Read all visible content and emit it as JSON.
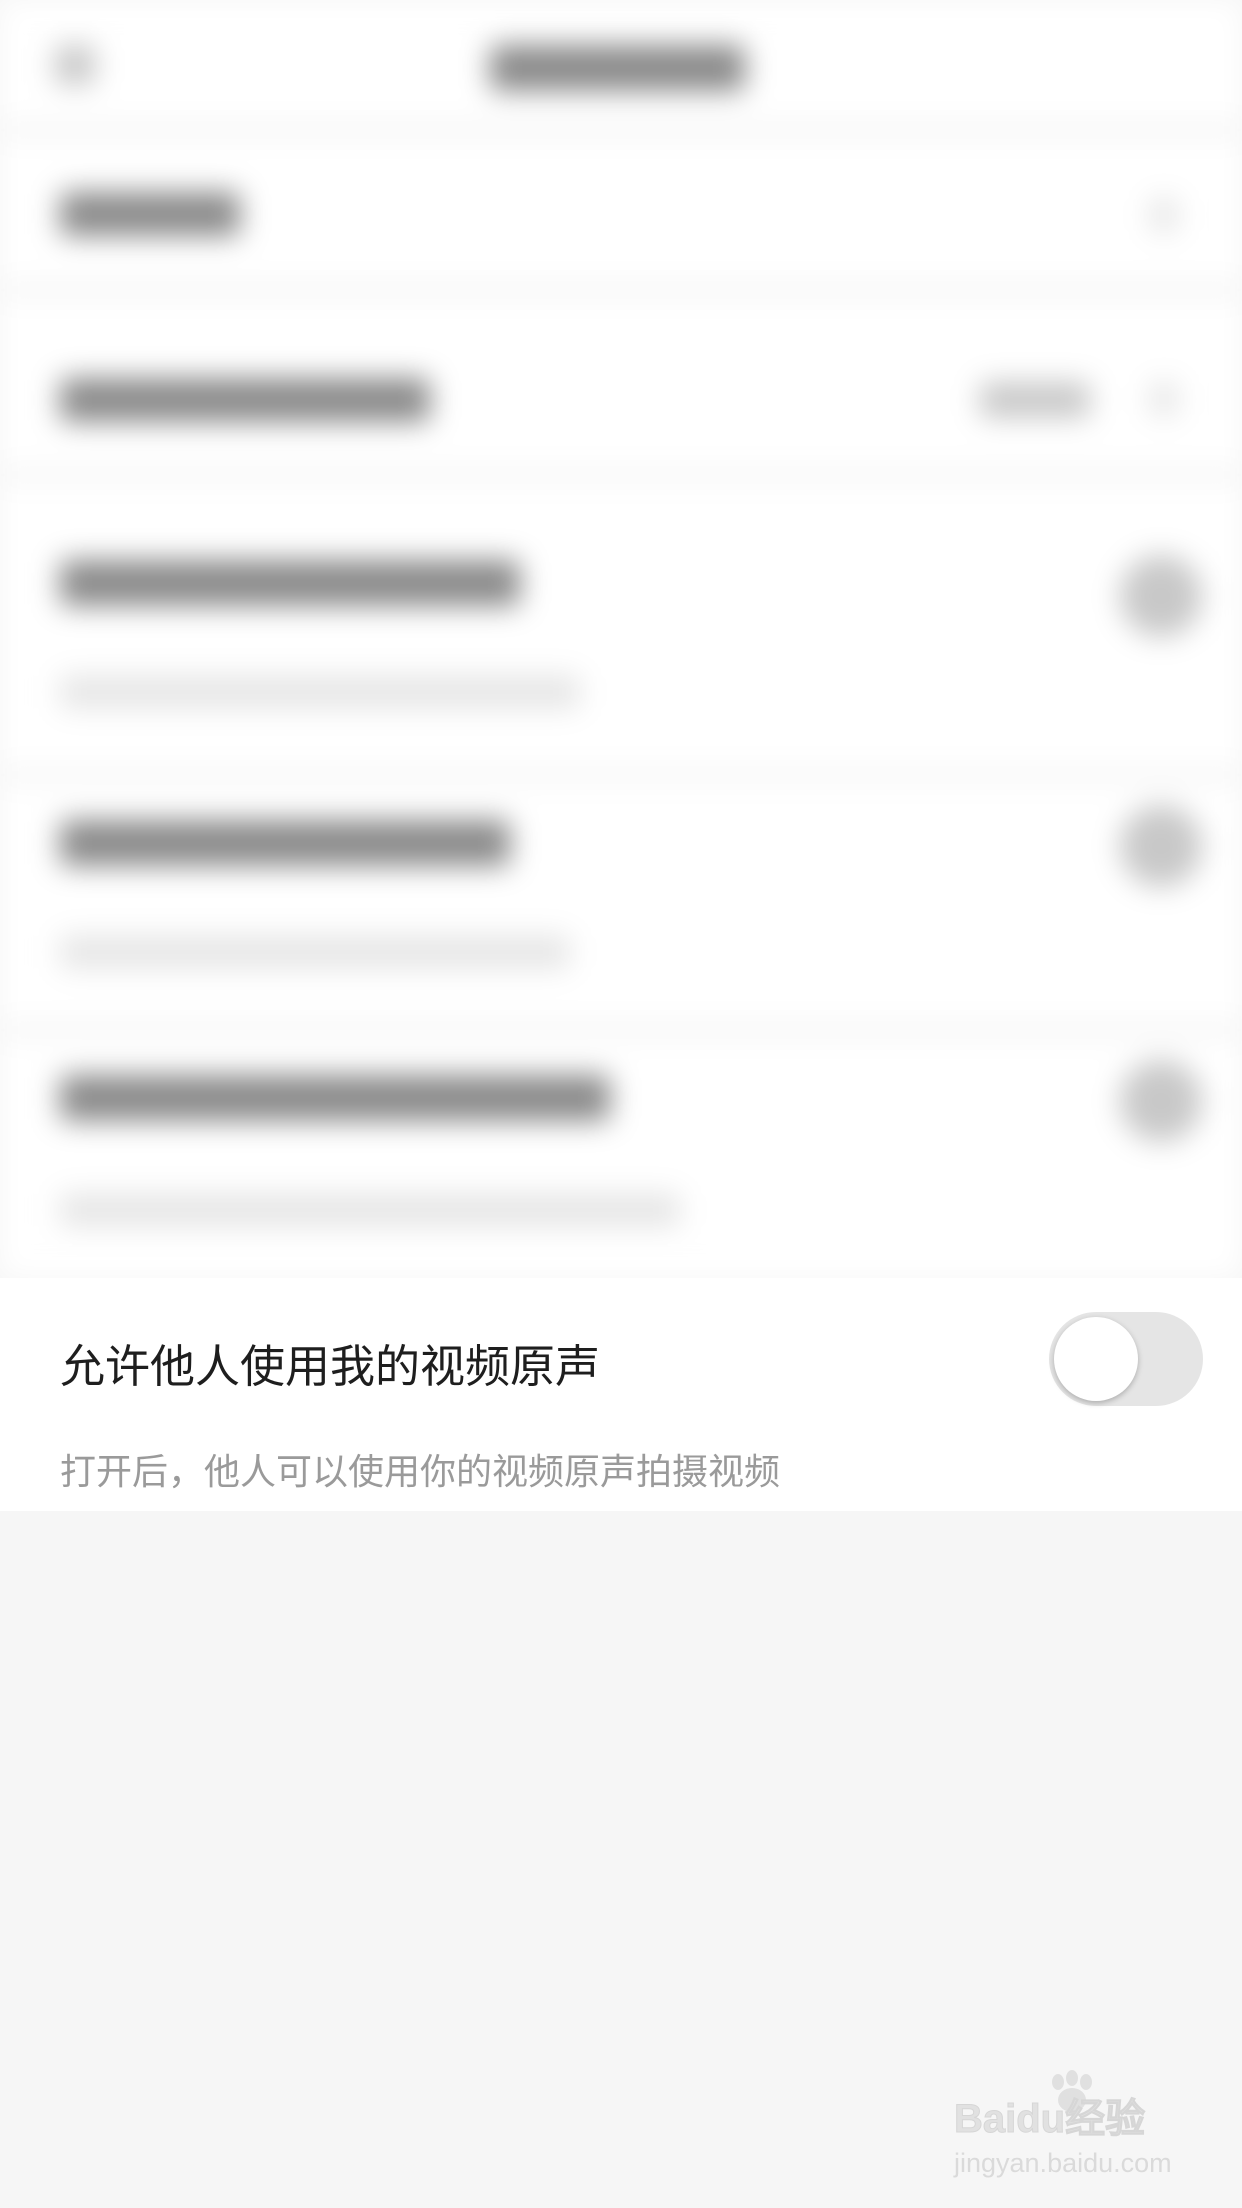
{
  "setting": {
    "title": "允许他人使用我的视频原声",
    "description": "打开后，他人可以使用你的视频原声拍摄视频",
    "enabled": false
  },
  "watermark": {
    "logo_text": "Baidu经验",
    "url": "jingyan.baidu.com"
  }
}
